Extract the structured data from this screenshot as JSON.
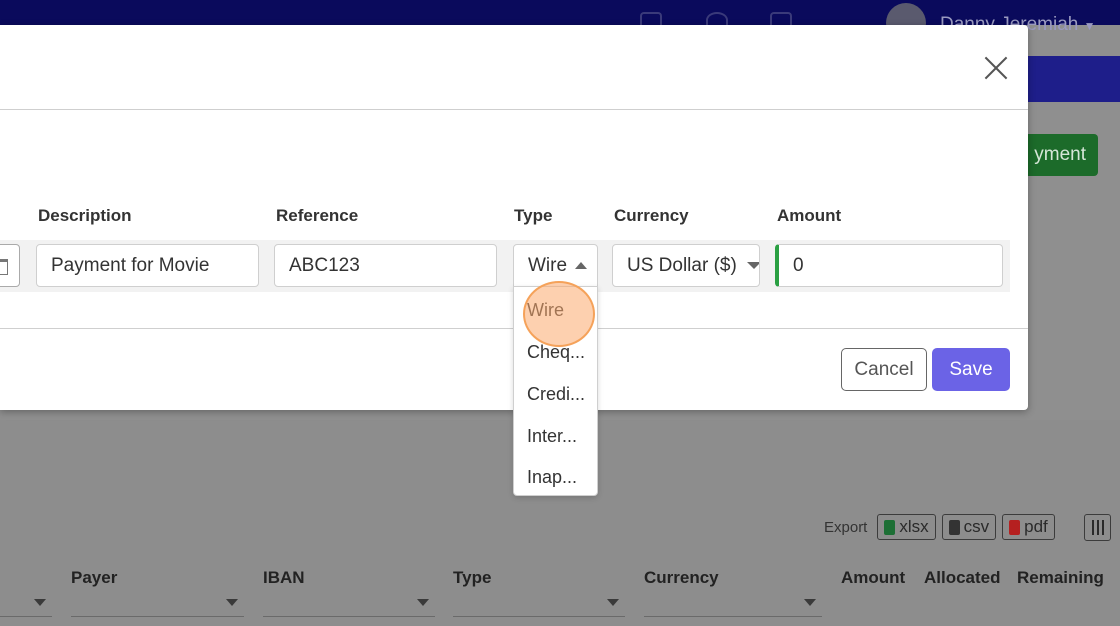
{
  "header": {
    "user_name": "Danny Jeremiah"
  },
  "background": {
    "green_button_label": "yment",
    "export_label": "Export",
    "export_buttons": [
      {
        "label": "xlsx",
        "icon": "excel-file-icon",
        "color": "#1d6f35"
      },
      {
        "label": "csv",
        "icon": "csv-file-icon",
        "color": "#333333"
      },
      {
        "label": "pdf",
        "icon": "pdf-file-icon",
        "color": "#b52020"
      }
    ],
    "columns": [
      "Payer",
      "IBAN",
      "Type",
      "Currency",
      "Amount",
      "Allocated",
      "Remaining"
    ]
  },
  "modal": {
    "labels": {
      "description": "Description",
      "reference": "Reference",
      "type": "Type",
      "currency": "Currency",
      "amount": "Amount"
    },
    "values": {
      "description": "Payment for Movie",
      "reference": "ABC123",
      "type": "Wire",
      "currency": "US Dollar ($)",
      "amount": "0"
    },
    "type_options": [
      "Wire",
      "Cheq...",
      "Credi...",
      "Inter...",
      "Inap..."
    ],
    "buttons": {
      "cancel": "Cancel",
      "save": "Save"
    }
  },
  "colors": {
    "primary": "#6b63e6",
    "success": "#2aa043",
    "navbar": "#0a0a5c",
    "highlight": "#f5a25a"
  }
}
